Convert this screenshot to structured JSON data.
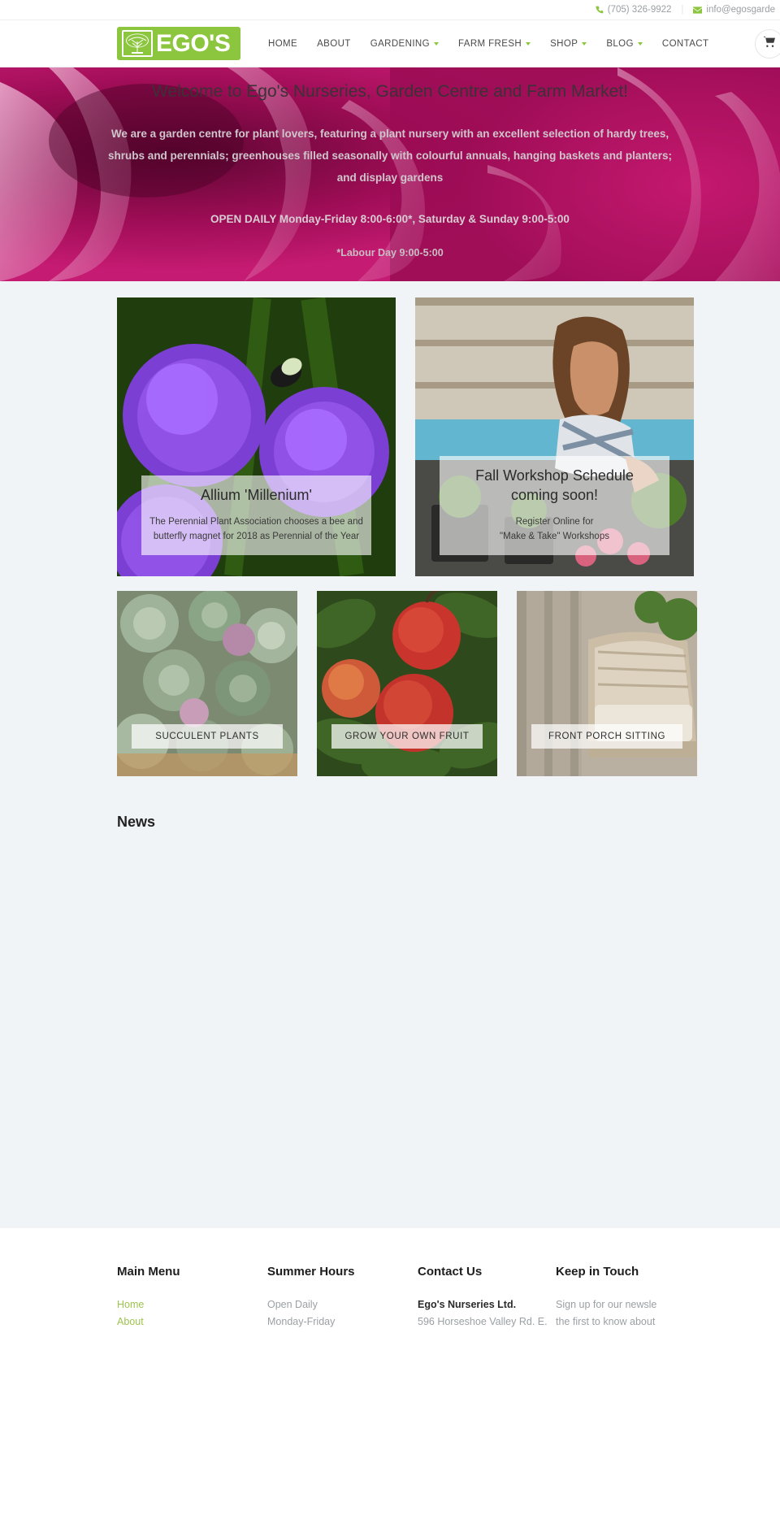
{
  "topbar": {
    "phone": "(705) 326-9922",
    "phone_icon": "phone-icon",
    "email": "info@egosgarde",
    "email_icon": "envelope-icon",
    "separator": "|"
  },
  "header": {
    "logo_text": "EGO'S",
    "logo_mark_icon": "tree-logo-icon",
    "cart_icon": "shopping-cart-icon",
    "nav": [
      {
        "label": "HOME",
        "has_caret": false
      },
      {
        "label": "ABOUT",
        "has_caret": false
      },
      {
        "label": "GARDENING",
        "has_caret": true
      },
      {
        "label": "FARM FRESH",
        "has_caret": true
      },
      {
        "label": "SHOP",
        "has_caret": true
      },
      {
        "label": "BLOG",
        "has_caret": true
      },
      {
        "label": "CONTACT",
        "has_caret": false
      }
    ]
  },
  "hero": {
    "title": "Welcome to Ego's Nurseries, Garden Centre and Farm Market!",
    "paragraph_line1": "We are a garden centre for plant lovers, featuring a plant nursery with an excellent selection of hardy trees,",
    "paragraph_line2": "shrubs and perennials; greenhouses filled seasonally with colourful annuals, hanging baskets and planters;",
    "paragraph_line3": "and display gardens",
    "hours": "OPEN DAILY  Monday-Friday 8:00-6:00*,  Saturday & Sunday 9:00-5:00",
    "note": "*Labour Day 9:00-5:00"
  },
  "feature_cards": [
    {
      "title": "Allium 'Millenium'",
      "body_line1": "The Perennial Plant Association chooses a bee and",
      "body_line2": "butterfly magnet for 2018 as Perennial of the Year",
      "image_alt": "purple allium flowers with bumblebee"
    },
    {
      "title_line1": "Fall Workshop Schedule",
      "title_line2": "coming soon!",
      "body_line1": "Register Online for",
      "body_line2": "\"Make & Take\" Workshops",
      "image_alt": "woman potting plants at garden centre"
    }
  ],
  "category_cards": [
    {
      "label": "SUCCULENT PLANTS",
      "image_alt": "assorted succulent plants"
    },
    {
      "label": "GROW YOUR OWN FRUIT",
      "image_alt": "red apples on tree"
    },
    {
      "label": "FRONT PORCH SITTING",
      "image_alt": "wicker patio chair"
    }
  ],
  "news": {
    "heading": "News"
  },
  "footer": {
    "columns": [
      {
        "heading": "Main Menu",
        "links": [
          "Home",
          "About"
        ]
      },
      {
        "heading": "Summer Hours",
        "lines": [
          "Open Daily",
          "Monday-Friday"
        ]
      },
      {
        "heading": "Contact Us",
        "name": "Ego's Nurseries Ltd.",
        "address": "596 Horseshoe Valley Rd. E."
      },
      {
        "heading": "Keep in Touch",
        "line1": "Sign up for our newsle",
        "line2": "the first to know about"
      }
    ]
  },
  "colors": {
    "brand_green": "#8cc63e",
    "link_green": "#9ec44f",
    "page_bg": "#f1f4f6",
    "hero_magenta": "#a8125c"
  }
}
